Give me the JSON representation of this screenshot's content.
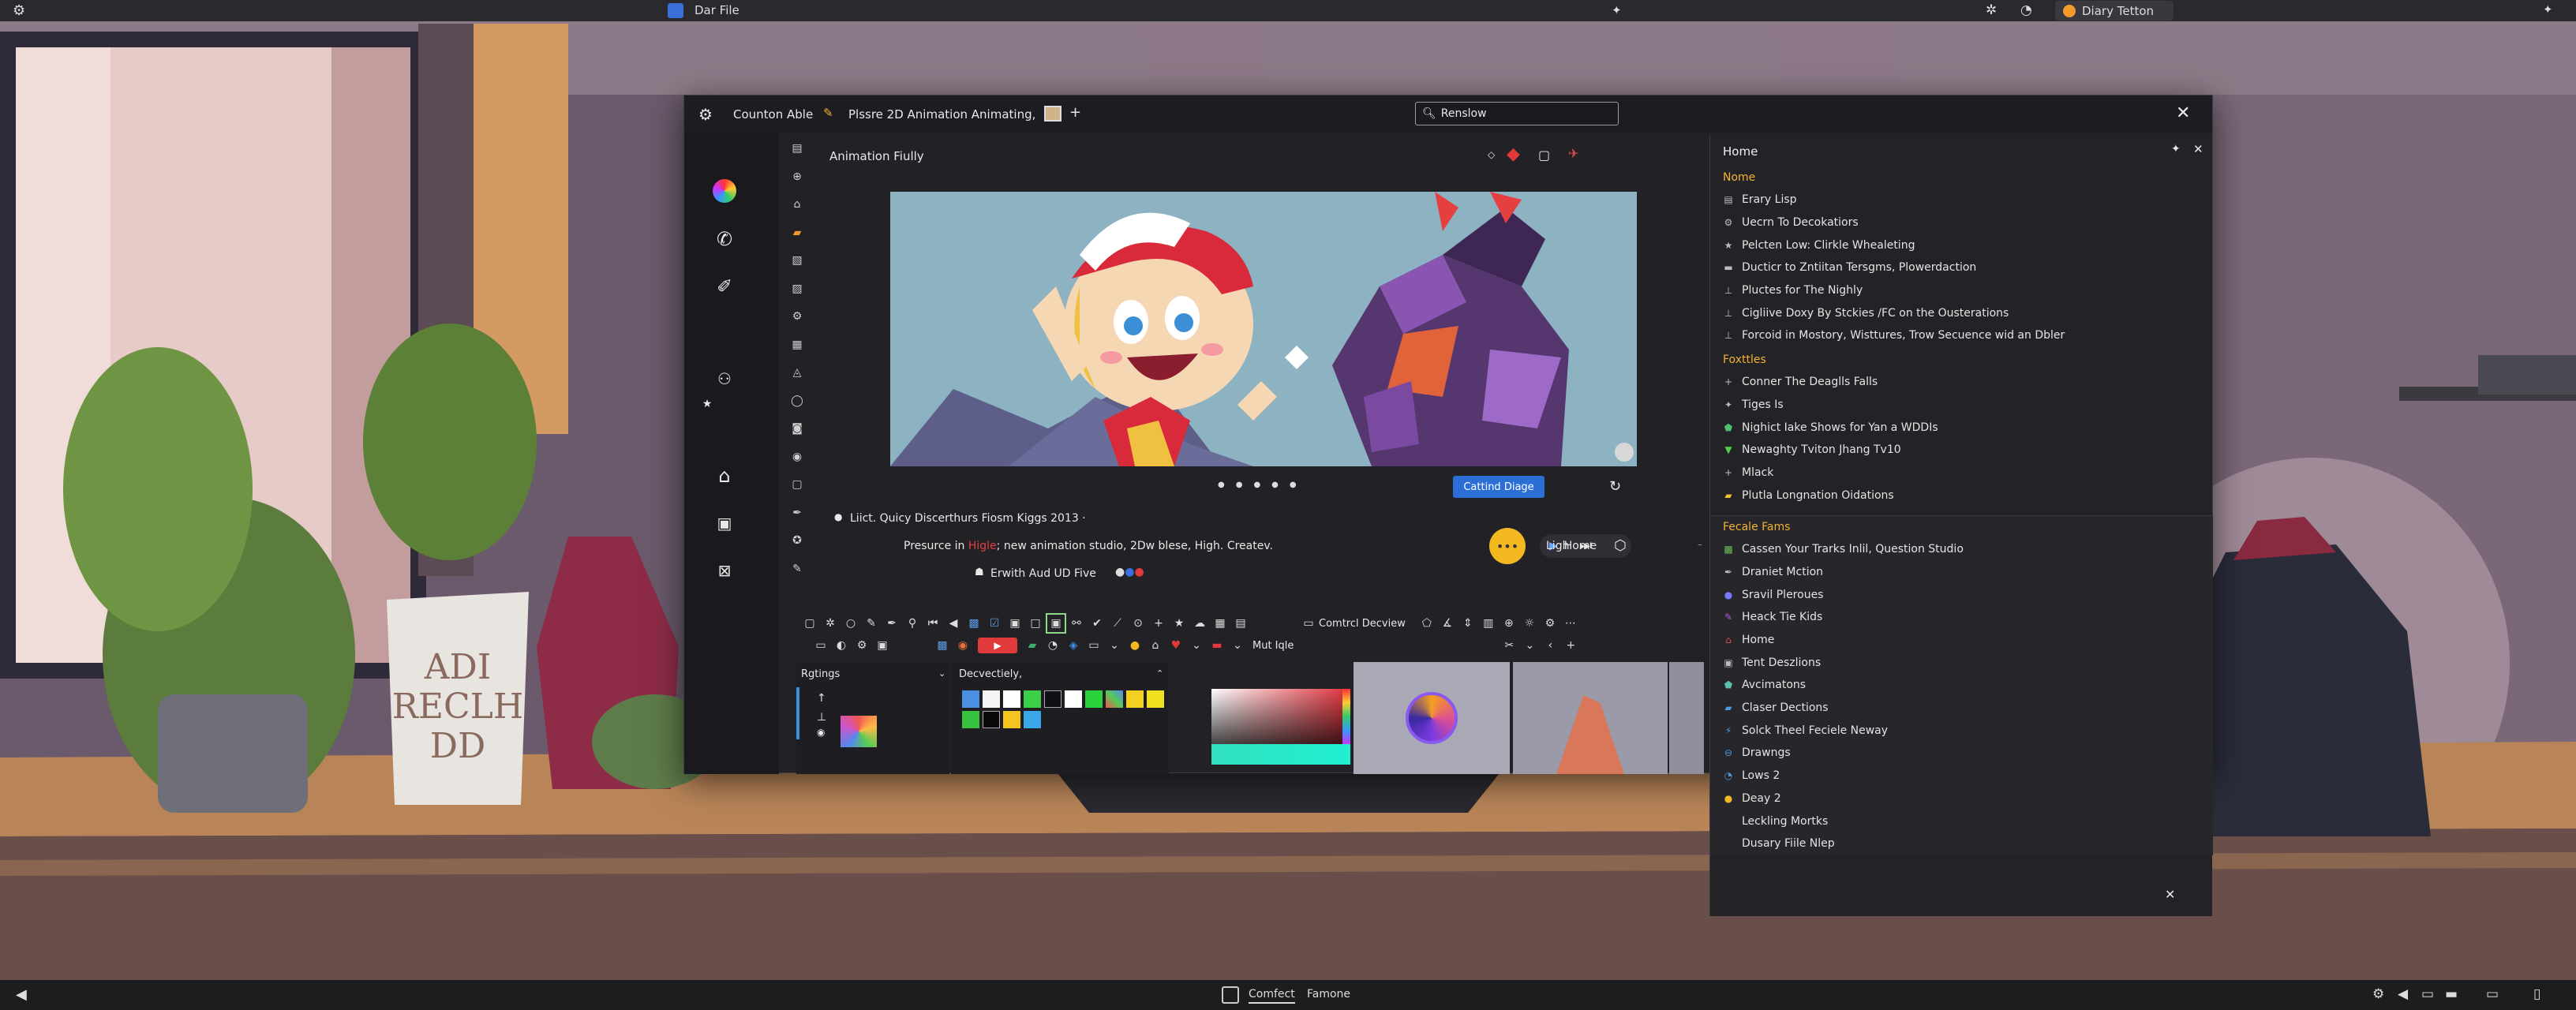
{
  "topbar": {
    "app_label": "Dar File",
    "right_tab": "Diary Tetton"
  },
  "window": {
    "tab1": "Counton Able",
    "tab2": "Plssre 2D Animation Animating,",
    "search_value": "Renslow",
    "canvas_title": "Animation Fiully"
  },
  "editor": {
    "meta_line": "Liict.   Quicy  Discerthurs  Fiosm Kiggs   2013  ·",
    "desc_prefix": "Presurce in ",
    "desc_highlight": "Higle",
    "desc_suffix": "; new animation studio, 2Dw blese, High. Createv.",
    "home_label": "Home",
    "sub_line": "Erwith Aud UD Five",
    "primary_button": "Cattind Diage",
    "ligh_label": "Ligh",
    "control_label": "Comtrcl Decview",
    "mut_label": "Mut Iqle",
    "panel1_title": "Rgtings",
    "panel2_title": "Decvectiely,"
  },
  "rightpanel": {
    "title": "Home",
    "sections": [
      {
        "title": "Nome",
        "items": [
          {
            "label": "Erary Lisp",
            "icon": "doc-icon"
          },
          {
            "label": "Uecrn To Decokatiors",
            "icon": "gear-icon"
          },
          {
            "label": "Pelcten Low: Clirkle Whealeting",
            "icon": "star-icon"
          },
          {
            "label": "Ducticr to Zntiitan Tersgms, Plowerdaction",
            "icon": "box-icon"
          },
          {
            "label": "Pluctes for The Nighly",
            "icon": "pin-icon"
          },
          {
            "label": "Cigliive Doxy By Stckies /FC on the Ousterations",
            "icon": "pin-icon"
          },
          {
            "label": "Forcoid in Mostory, Wisttures, Trow Secuence wid an Dbler",
            "icon": "pin-icon"
          }
        ]
      },
      {
        "title": "Foxttles",
        "items": [
          {
            "label": "Conner The Deaglls Falls",
            "icon": "plus-icon"
          },
          {
            "label": "Tiges Is",
            "icon": "sparkle-icon"
          },
          {
            "label": "Nighict Iake Shows for Yan a WDDIs",
            "icon": "shield-icon"
          },
          {
            "label": "Newaghty Tviton Jhang Tv10",
            "icon": "filter-icon"
          },
          {
            "label": "Mlack",
            "icon": "plus-icon"
          },
          {
            "label": "Plutla Longnation Oidations",
            "icon": "folder-icon"
          }
        ]
      },
      {
        "title": "Fecale Fams",
        "items": [
          {
            "label": "Cassen Your Trarks Inlil, Question Studio",
            "icon": "image-icon"
          },
          {
            "label": "Draniet Mction",
            "icon": "brush-icon"
          },
          {
            "label": "Sravil Pleroues",
            "icon": "globe-icon"
          },
          {
            "label": "Heack Tie Kids",
            "icon": "brush-icon"
          },
          {
            "label": "Home",
            "icon": "home-icon"
          },
          {
            "label": "Tent Deszlions",
            "icon": "tag-icon"
          },
          {
            "label": "Avcimatons",
            "icon": "shield-icon"
          },
          {
            "label": "Claser Dections",
            "icon": "folder-icon"
          },
          {
            "label": "Solck Theel Feciele Neway",
            "icon": "bolt-icon"
          },
          {
            "label": "Drawngs",
            "icon": "minus-icon"
          },
          {
            "label": "Lows 2",
            "icon": "clock-icon"
          },
          {
            "label": "Deay 2",
            "icon": "coin-icon"
          },
          {
            "label": "Leckling Mortks",
            "icon": ""
          },
          {
            "label": "Dusary Fiile Nlep",
            "icon": ""
          }
        ]
      }
    ]
  },
  "taskbar": {
    "item1": "Comfect",
    "item2": "Famone"
  },
  "colors": {
    "accent_blue": "#2b6fd6",
    "section_orange": "#f2b233",
    "window_bg": "#222226",
    "panel_bg": "#232327"
  }
}
